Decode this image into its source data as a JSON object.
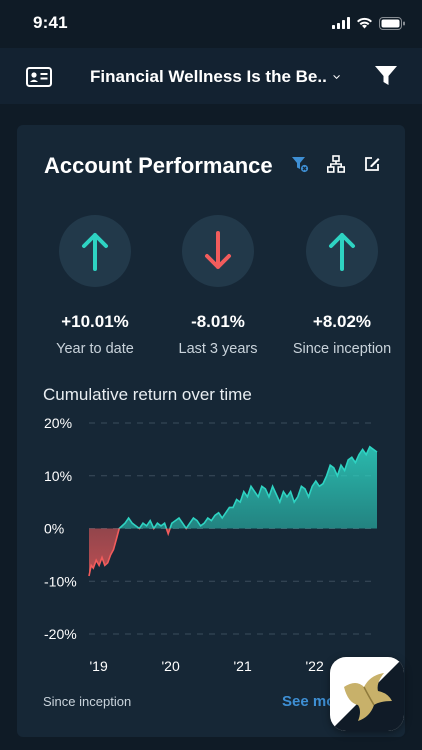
{
  "status_bar": {
    "time": "9:41"
  },
  "navbar": {
    "title": "Financial Wellness Is the Be..",
    "left_icon": "id-card-icon",
    "filter_icon": "filter-icon"
  },
  "card": {
    "title": "Account Performance",
    "tools": [
      "filter-settings-icon",
      "hierarchy-icon",
      "edit-icon"
    ],
    "metrics": [
      {
        "value": "+10.01%",
        "label": "Year to date",
        "direction": "up",
        "color": "#2ed3c2"
      },
      {
        "value": "-8.01%",
        "label": "Last 3 years",
        "direction": "down",
        "color": "#f25c5c"
      },
      {
        "value": "+8.02%",
        "label": "Since inception",
        "direction": "up",
        "color": "#2ed3c2"
      }
    ],
    "chart_title": "Cumulative return over time",
    "footer_left": "Since inception",
    "footer_link": "See mo"
  },
  "colors": {
    "positive": "#2ed3c2",
    "negative": "#f25c5c",
    "link": "#3e8fd4"
  },
  "chart_data": {
    "type": "area",
    "xlabel": "",
    "ylabel": "",
    "ylim": [
      -20,
      20
    ],
    "xlim": [
      2019.0,
      2023.0
    ],
    "y_ticks": [
      "20%",
      "10%",
      "0%",
      "-10%",
      "-20%"
    ],
    "y_tick_values": [
      20,
      10,
      0,
      -10,
      -20
    ],
    "x_ticks": [
      "'19",
      "'20",
      "'21",
      "'22"
    ],
    "x_tick_values": [
      2019,
      2020,
      2021,
      2022
    ],
    "grid": "dashed-horizontal",
    "series": [
      {
        "x": [
          2019.0,
          2019.03,
          2019.06,
          2019.1,
          2019.14,
          2019.18,
          2019.22,
          2019.26,
          2019.3,
          2019.34,
          2019.38,
          2019.42,
          2019.46,
          2019.5,
          2019.55,
          2019.6,
          2019.65,
          2019.7,
          2019.75,
          2019.8,
          2019.85,
          2019.9,
          2019.95,
          2020.0,
          2020.05,
          2020.1,
          2020.15,
          2020.2,
          2020.25,
          2020.3,
          2020.35,
          2020.4,
          2020.45,
          2020.5,
          2020.55,
          2020.6,
          2020.65,
          2020.7,
          2020.75,
          2020.8,
          2020.85,
          2020.9,
          2020.95,
          2021.0,
          2021.05,
          2021.1,
          2021.15,
          2021.2,
          2021.25,
          2021.3,
          2021.35,
          2021.4,
          2021.45,
          2021.5,
          2021.55,
          2021.6,
          2021.65,
          2021.7,
          2021.75,
          2021.8,
          2021.85,
          2021.9,
          2021.95,
          2022.0,
          2022.05,
          2022.1,
          2022.15,
          2022.2,
          2022.25,
          2022.3,
          2022.35,
          2022.4,
          2022.45,
          2022.5,
          2022.55,
          2022.6,
          2022.65,
          2022.7,
          2022.75,
          2022.8,
          2022.85,
          2022.9,
          2022.95,
          2023.0
        ],
        "y": [
          -9,
          -7,
          -7.5,
          -6,
          -7,
          -5.5,
          -7,
          -6.5,
          -5,
          -4,
          -2,
          0,
          0.5,
          1,
          2,
          1,
          0.5,
          0,
          1,
          0.5,
          1.5,
          0,
          1,
          0.5,
          1,
          -1,
          1,
          1.5,
          2,
          1,
          0,
          1,
          2,
          1.5,
          0.5,
          1,
          2,
          1.5,
          2.5,
          3,
          2,
          3,
          4,
          4,
          5.5,
          5,
          7,
          6,
          8,
          7,
          6,
          8,
          7.5,
          6,
          8,
          6.5,
          5,
          7,
          6,
          7,
          5,
          6,
          8,
          7.5,
          6,
          8,
          9,
          8,
          8.5,
          10,
          12,
          11.5,
          10,
          12,
          11,
          13,
          13.5,
          12.5,
          14,
          15,
          14,
          15.5,
          15,
          14.5
        ]
      }
    ]
  }
}
